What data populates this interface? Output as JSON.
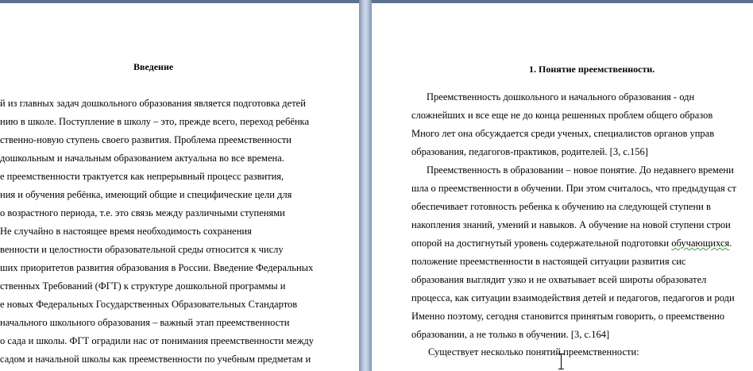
{
  "left_page": {
    "heading": "Введение",
    "lines": [
      "й из главных задач дошкольного образования является подготовка детей",
      "нию в школе. Поступление в школу – это, прежде всего, переход ребёнка",
      "ственно-новую ступень своего развития. Проблема преемственности",
      "дошкольным и начальным образованием актуальна во все времена.",
      "е преемственности трактуется как непрерывный процесс развития,",
      "ния и обучения ребёнка, имеющий общие и специфические цели для",
      "о возрастного периода, т.е. это связь между различными ступенями",
      "Не случайно в настоящее время необходимость сохранения",
      "венности и целостности образовательной среды относится к числу",
      "ших приоритетов развития образования в России. Введение Федеральных",
      "ственных Требований (ФГТ) к структуре дошкольной программы и",
      "е новых Федеральных Государственных Образовательных Стандартов",
      "начального школьного образования – важный этап преемственности",
      "о сада и школы. ФГТ оградили нас от понимания преемственности между",
      "садом и начальной школы как преемственности по учебным предметам и"
    ]
  },
  "right_page": {
    "heading": "1.  Понятие преемственности.",
    "lines": [
      "Преемственность дошкольного и начального образования - одн",
      "сложнейших и все еще не до конца решенных проблем общего образов",
      "Много лет она обсуждается среди ученых, специалистов органов управ",
      "образования, педагогов-практиков, родителей. [3, с.156]",
      "Преемственность в образовании – новое понятие. До недавнего времени",
      "шла о преемственности в обучении. При этом считалось, что предыдущая ст",
      "обеспечивает готовность ребенка к обучению на следующей ступени в",
      "накопления знаний, умений и навыков. А обучение на новой ступени строи",
      "опорой на достигнутый уровень содержательной подготовки обучающихся.",
      "положение преемственности в настоящей ситуации развития сис",
      "образования выглядит узко и не охватывает всей широты образовател",
      "процесса, как ситуации взаимодействия детей и педагогов, педагогов и роди",
      "Именно поэтому, сегодня становится принятым говорить, о преемственно",
      "образовании, а не только в обучении. [3, с.164]",
      "Существует несколько понятий преемственности:"
    ]
  }
}
